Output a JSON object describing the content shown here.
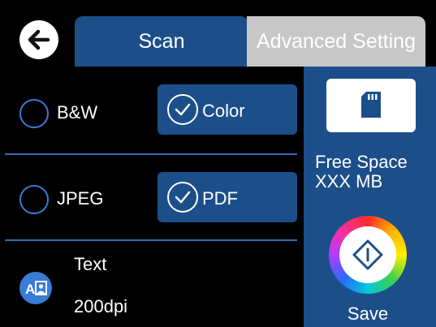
{
  "header": {
    "tabs": [
      {
        "label": "Scan",
        "selected": true
      },
      {
        "label": "Advanced Setting",
        "selected": false
      }
    ]
  },
  "options": {
    "color_mode": {
      "left": "B&W",
      "right": "Color",
      "selected": "Color"
    },
    "file_format": {
      "left": "JPEG",
      "right": "PDF",
      "selected": "PDF"
    },
    "scan_setting": {
      "type": "Text",
      "resolution": "200dpi"
    }
  },
  "sidebar": {
    "free_space_label": "Free Space",
    "free_space_value": "XXX MB",
    "save_label": "Save"
  },
  "icons": {
    "back": "back-arrow-icon",
    "memory_card": "memory-card-icon",
    "document_type": "document-type-icon",
    "start": "start-diamond-icon"
  },
  "colors": {
    "selected_blue": "#1c4f8a",
    "radio_blue": "#3a7bd5",
    "inactive_tab": "#c7c7c7",
    "background": "#000000"
  }
}
